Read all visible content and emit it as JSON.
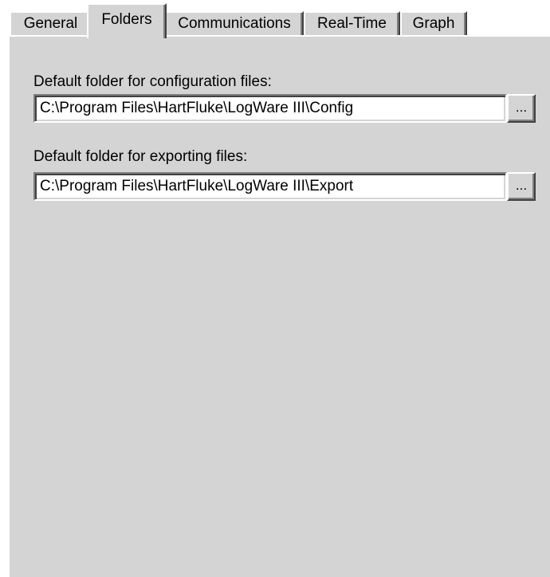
{
  "tabs": [
    {
      "label": "General",
      "active": false
    },
    {
      "label": "Folders",
      "active": true
    },
    {
      "label": "Communications",
      "active": false
    },
    {
      "label": "Real-Time",
      "active": false
    },
    {
      "label": "Graph",
      "active": false
    }
  ],
  "folders": {
    "config_label": "Default folder for configuration files:",
    "config_path": "C:\\Program Files\\HartFluke\\LogWare III\\Config",
    "export_label": "Default folder for exporting files:",
    "export_path": "C:\\Program Files\\HartFluke\\LogWare III\\Export",
    "browse_label": "..."
  },
  "colors": {
    "panel_bg": "#d4d4d4",
    "page_bg": "#ffffff"
  }
}
